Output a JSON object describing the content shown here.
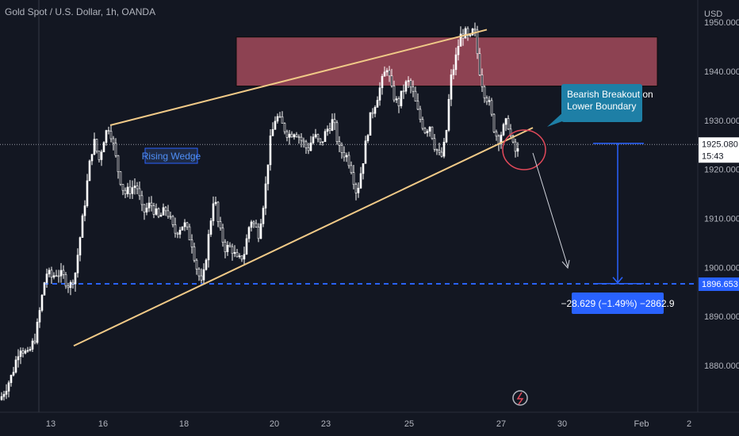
{
  "chart_data": {
    "type": "candlestick",
    "title": "Gold Spot / U.S. Dollar, 1h, OANDA",
    "currency": "USD",
    "ylim": [
      1871,
      1952
    ],
    "y_ticks": [
      {
        "value": 1950,
        "label": "1950.000"
      },
      {
        "value": 1940,
        "label": "1940.000"
      },
      {
        "value": 1930,
        "label": "1930.000"
      },
      {
        "value": 1920,
        "label": "1920.000"
      },
      {
        "value": 1910,
        "label": "1910.000"
      },
      {
        "value": 1900,
        "label": "1900.000"
      },
      {
        "value": 1890,
        "label": "1890.000"
      },
      {
        "value": 1880,
        "label": "1880.000"
      }
    ],
    "x_ticks": [
      "13",
      "16",
      "18",
      "20",
      "23",
      "25",
      "27",
      "30",
      "Feb",
      "2"
    ],
    "price_path": [
      [
        0,
        1873
      ],
      [
        15,
        1878
      ],
      [
        25,
        1884
      ],
      [
        35,
        1882
      ],
      [
        45,
        1886
      ],
      [
        52,
        1893
      ],
      [
        58,
        1899
      ],
      [
        65,
        1898
      ],
      [
        72,
        1899
      ],
      [
        80,
        1898
      ],
      [
        88,
        1896
      ],
      [
        95,
        1899
      ],
      [
        100,
        1905
      ],
      [
        106,
        1912
      ],
      [
        112,
        1920
      ],
      [
        118,
        1926
      ],
      [
        125,
        1922
      ],
      [
        132,
        1927
      ],
      [
        138,
        1929
      ],
      [
        144,
        1924
      ],
      [
        150,
        1919
      ],
      [
        157,
        1915
      ],
      [
        165,
        1916
      ],
      [
        172,
        1917
      ],
      [
        180,
        1911
      ],
      [
        190,
        1913
      ],
      [
        200,
        1910
      ],
      [
        210,
        1912
      ],
      [
        220,
        1907
      ],
      [
        232,
        1909
      ],
      [
        242,
        1905
      ],
      [
        248,
        1900
      ],
      [
        255,
        1896
      ],
      [
        262,
        1905
      ],
      [
        270,
        1915
      ],
      [
        276,
        1908
      ],
      [
        284,
        1904
      ],
      [
        292,
        1904
      ],
      [
        300,
        1901
      ],
      [
        308,
        1903
      ],
      [
        316,
        1910
      ],
      [
        326,
        1907
      ],
      [
        334,
        1915
      ],
      [
        340,
        1925
      ],
      [
        348,
        1931
      ],
      [
        356,
        1929
      ],
      [
        364,
        1927
      ],
      [
        372,
        1928
      ],
      [
        380,
        1926
      ],
      [
        388,
        1924
      ],
      [
        396,
        1927
      ],
      [
        404,
        1925
      ],
      [
        412,
        1928
      ],
      [
        420,
        1930
      ],
      [
        428,
        1924
      ],
      [
        436,
        1923
      ],
      [
        442,
        1921
      ],
      [
        450,
        1915
      ],
      [
        458,
        1922
      ],
      [
        466,
        1930
      ],
      [
        474,
        1934
      ],
      [
        482,
        1938
      ],
      [
        488,
        1941
      ],
      [
        494,
        1936
      ],
      [
        502,
        1933
      ],
      [
        508,
        1936
      ],
      [
        514,
        1938
      ],
      [
        520,
        1936
      ],
      [
        528,
        1931
      ],
      [
        536,
        1928
      ],
      [
        542,
        1929
      ],
      [
        548,
        1925
      ],
      [
        556,
        1922
      ],
      [
        562,
        1926
      ],
      [
        568,
        1938
      ],
      [
        574,
        1942
      ],
      [
        580,
        1947
      ],
      [
        586,
        1948
      ],
      [
        592,
        1946
      ],
      [
        598,
        1949
      ],
      [
        604,
        1941
      ],
      [
        610,
        1936
      ],
      [
        616,
        1934
      ],
      [
        622,
        1929
      ],
      [
        628,
        1926
      ],
      [
        634,
        1928
      ],
      [
        640,
        1930
      ],
      [
        646,
        1925
      ],
      [
        652,
        1923
      ],
      [
        655,
        1925
      ]
    ],
    "last_price": {
      "value": 1925.08,
      "label": "1925.080",
      "countdown": "15:43"
    },
    "target_level": {
      "value": 1896.653,
      "label": "1896.653"
    },
    "wedge_label": "Rising Wedge",
    "breakout_label_line1": "Bearish Breakout on",
    "breakout_label_line2": "Lower Boundary",
    "measure_label": "−28.629 (−1.49%) −2862.9",
    "resistance_zone": {
      "top": 1947,
      "bottom": 1937
    },
    "colors": {
      "background": "#131722",
      "candle": "#ffffff",
      "wedge": "#f0c987",
      "zone_fill": "#a34a5a",
      "dashed_level": "#2962ff",
      "callout": "#1e7fa6",
      "measure_box": "#2962ff",
      "circle": "#e0495a",
      "target_tag": "#2962ff"
    }
  }
}
